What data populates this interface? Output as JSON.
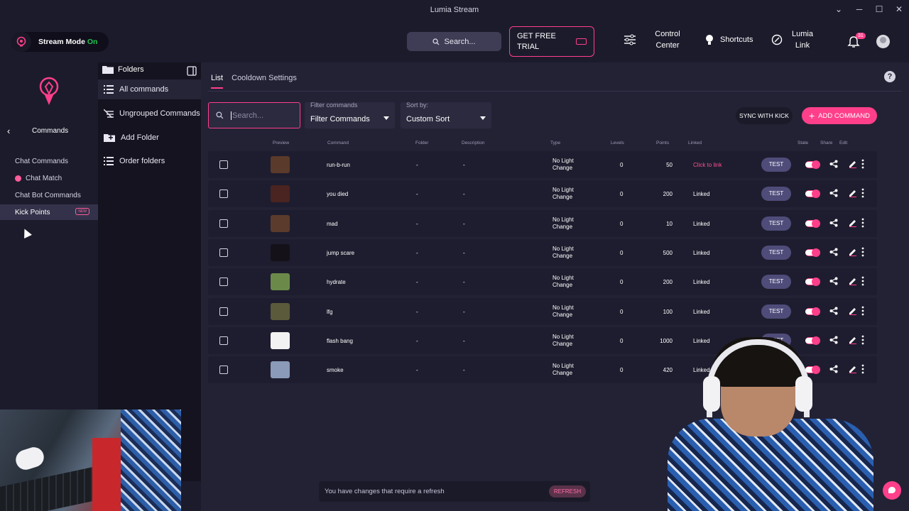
{
  "window": {
    "title": "Lumia Stream",
    "minimize": "─",
    "maximize": "☐",
    "close": "✕",
    "chevron": "⌄"
  },
  "topbar": {
    "stream_mode_label": "Stream Mode",
    "stream_mode_state": "On",
    "search_label": "Search...",
    "trial_label": "GET FREE TRIAL",
    "control_center": "Control Center",
    "shortcuts": "Shortcuts",
    "lumia_link": "Lumia Link",
    "notification_count": "31"
  },
  "leftnav": {
    "section_title": "Commands",
    "items": [
      {
        "label": "Chat Commands",
        "active": false
      },
      {
        "label": "Chat Match",
        "active": false
      },
      {
        "label": "Chat Bot Commands",
        "active": false
      },
      {
        "label": "Kick Points",
        "active": true,
        "badge": "NEW"
      }
    ]
  },
  "folders": {
    "header": "Folders",
    "items": [
      {
        "label": "All commands",
        "icon": "list-icon"
      },
      {
        "label": "Ungrouped Commands",
        "icon": "no-folder-icon"
      },
      {
        "label": "Add Folder",
        "icon": "add-folder-icon"
      },
      {
        "label": "Order folders",
        "icon": "order-icon"
      }
    ]
  },
  "main": {
    "tabs": [
      "List",
      "Cooldown Settings"
    ],
    "search_placeholder": "Search...",
    "filter_label": "Filter commands",
    "filter_value": "Filter Commands",
    "sort_label": "Sort by:",
    "sort_value": "Custom Sort",
    "sync_button": "SYNC WITH KICK",
    "add_button": "ADD COMMAND",
    "columns": {
      "preview": "Preview",
      "command": "Command",
      "folder": "Folder",
      "description": "Description",
      "type": "Type",
      "levels": "Levels",
      "points": "Points",
      "linked": "Linked",
      "state": "State",
      "share": "Share",
      "edit": "Edit"
    },
    "rows": [
      {
        "command": "run-b-run",
        "folder": "-",
        "description": "-",
        "type_line1": "No Light",
        "type_line2": "Change",
        "levels": "0",
        "points": "50",
        "linked": "Click to link",
        "linked_pink": true,
        "test": "TEST",
        "thumb": "#5a3a2a"
      },
      {
        "command": "you died",
        "folder": "-",
        "description": "-",
        "type_line1": "No Light",
        "type_line2": "Change",
        "levels": "0",
        "points": "200",
        "linked": "Linked",
        "linked_pink": false,
        "test": "TEST",
        "thumb": "#4a2420"
      },
      {
        "command": "mad",
        "folder": "-",
        "description": "-",
        "type_line1": "No Light",
        "type_line2": "Change",
        "levels": "0",
        "points": "10",
        "linked": "Linked",
        "linked_pink": false,
        "test": "TEST",
        "thumb": "#5b3b2c"
      },
      {
        "command": "jump scare",
        "folder": "-",
        "description": "-",
        "type_line1": "No Light",
        "type_line2": "Change",
        "levels": "0",
        "points": "500",
        "linked": "Linked",
        "linked_pink": false,
        "test": "TEST",
        "thumb": "#141218"
      },
      {
        "command": "hydrate",
        "folder": "-",
        "description": "-",
        "type_line1": "No Light",
        "type_line2": "Change",
        "levels": "0",
        "points": "200",
        "linked": "Linked",
        "linked_pink": false,
        "test": "TEST",
        "thumb": "#6b8a4a"
      },
      {
        "command": "lfg",
        "folder": "-",
        "description": "-",
        "type_line1": "No Light",
        "type_line2": "Change",
        "levels": "0",
        "points": "100",
        "linked": "Linked",
        "linked_pink": false,
        "test": "TEST",
        "thumb": "#5b5a3a"
      },
      {
        "command": "flash bang",
        "folder": "-",
        "description": "-",
        "type_line1": "No Light",
        "type_line2": "Change",
        "levels": "0",
        "points": "1000",
        "linked": "Linked",
        "linked_pink": false,
        "test": "TEST",
        "thumb": "#f2f2f2"
      },
      {
        "command": "smoke",
        "folder": "-",
        "description": "-",
        "type_line1": "No Light",
        "type_line2": "Change",
        "levels": "0",
        "points": "420",
        "linked": "Linked",
        "linked_pink": false,
        "test": "TEST",
        "thumb": "#8a9ab8"
      }
    ],
    "refresh_message": "You have changes that require a refresh",
    "refresh_button": "REFRESH"
  },
  "colors": {
    "accent": "#ff3f8a",
    "active_green": "#23c552",
    "test_button": "#4f4c7a"
  }
}
